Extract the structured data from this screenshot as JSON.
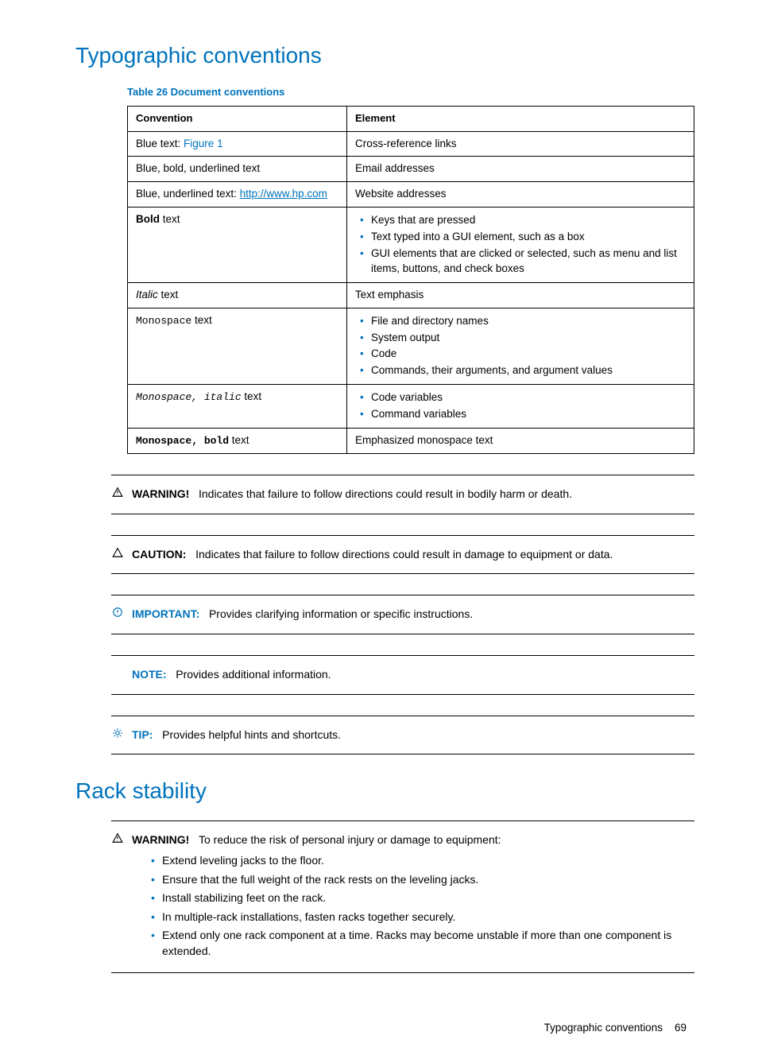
{
  "heading1": "Typographic conventions",
  "tableCaption": "Table 26   Document conventions",
  "table": {
    "headers": {
      "col1": "Convention",
      "col2": "Element"
    },
    "row1": {
      "pre": "Blue text: ",
      "link": "Figure 1",
      "elem": "Cross-reference links"
    },
    "row2": {
      "conv": "Blue, bold, underlined text",
      "elem": "Email addresses"
    },
    "row3": {
      "pre": "Blue, underlined text: ",
      "link": "http://www.hp.com",
      "elem": "Website addresses"
    },
    "row4": {
      "conv_bold": "Bold",
      "conv_rest": " text",
      "items": {
        "i1": "Keys that are pressed",
        "i2": "Text typed into a GUI element, such as a box",
        "i3": "GUI elements that are clicked or selected, such as menu and list items, buttons, and check boxes"
      }
    },
    "row5": {
      "conv_it": "Italic",
      "conv_rest": " text",
      "elem": "Text emphasis"
    },
    "row6": {
      "conv_mono": "Monospace",
      "conv_rest": " text",
      "items": {
        "i1": "File and directory names",
        "i2": "System output",
        "i3": "Code",
        "i4": "Commands, their arguments, and argument values"
      }
    },
    "row7": {
      "conv_mono": "Monospace, italic",
      "conv_rest": " text",
      "items": {
        "i1": "Code variables",
        "i2": "Command variables"
      }
    },
    "row8": {
      "conv_mono": "Monospace, bold",
      "conv_rest": " text",
      "elem": "Emphasized monospace text"
    }
  },
  "admon": {
    "warning": {
      "label": "WARNING!",
      "text": "Indicates that failure to follow directions could result in bodily harm or death."
    },
    "caution": {
      "label": "CAUTION:",
      "text": "Indicates that failure to follow directions could result in damage to equipment or data."
    },
    "important": {
      "label": "IMPORTANT:",
      "text": "Provides clarifying information or specific instructions."
    },
    "note": {
      "label": "NOTE:",
      "text": "Provides additional information."
    },
    "tip": {
      "label": "TIP:",
      "text": "Provides helpful hints and shortcuts."
    }
  },
  "heading2": "Rack stability",
  "rack": {
    "label": "WARNING!",
    "intro": "To reduce the risk of personal injury or damage to equipment:",
    "items": {
      "i1": "Extend leveling jacks to the floor.",
      "i2": "Ensure that the full weight of the rack rests on the leveling jacks.",
      "i3": "Install stabilizing feet on the rack.",
      "i4": "In multiple-rack installations, fasten racks together securely.",
      "i5": "Extend only one rack component at a time. Racks may become unstable if more than one component is extended."
    }
  },
  "footer": {
    "title": "Typographic conventions",
    "page": "69"
  }
}
